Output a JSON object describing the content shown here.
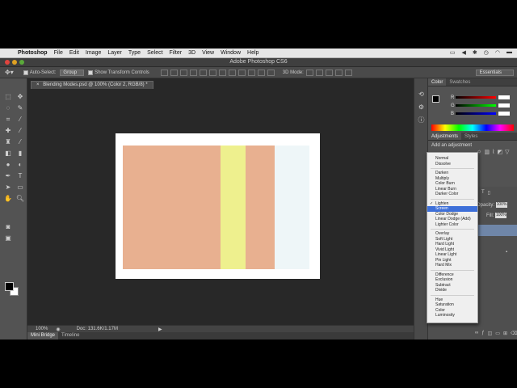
{
  "mac_menubar": {
    "items": [
      "Photoshop",
      "File",
      "Edit",
      "Image",
      "Layer",
      "Type",
      "Select",
      "Filter",
      "3D",
      "View",
      "Window",
      "Help"
    ]
  },
  "window": {
    "title": "Adobe Photoshop CS6"
  },
  "options_bar": {
    "auto_select_label": "Auto-Select:",
    "auto_select_value": "Group",
    "transform_label": "Show Transform Controls",
    "mode_label": "3D Mode:",
    "workspace": "Essentials"
  },
  "document": {
    "tab_title": "Blending Modes.psd @ 100% (Color 2, RGB/8) *",
    "zoom": "100%",
    "doc_size": "Doc: 131.6K/1.17M",
    "bottom_tabs": [
      "Mini Bridge",
      "Timeline"
    ]
  },
  "panels": {
    "color_tabs": [
      "Color",
      "Swatches"
    ],
    "slider_labels": [
      "R",
      "G",
      "B"
    ],
    "adjustments_tabs": [
      "Adjustments",
      "Styles"
    ],
    "add_adjustment": "Add an adjustment",
    "opacity_label": "Opacity:",
    "opacity_value": "100%",
    "fill_label": "Fill:",
    "fill_value": "100%"
  },
  "blend_menu": {
    "groups": [
      [
        {
          "label": "Normal"
        },
        {
          "label": "Dissolve"
        }
      ],
      [
        {
          "label": "Darken"
        },
        {
          "label": "Multiply"
        },
        {
          "label": "Color Burn"
        },
        {
          "label": "Linear Burn"
        },
        {
          "label": "Darker Color"
        }
      ],
      [
        {
          "label": "Lighten",
          "checked": true
        },
        {
          "label": "Screen",
          "highlighted": true
        },
        {
          "label": "Color Dodge"
        },
        {
          "label": "Linear Dodge (Add)"
        },
        {
          "label": "Lighter Color"
        }
      ],
      [
        {
          "label": "Overlay"
        },
        {
          "label": "Soft Light"
        },
        {
          "label": "Hard Light"
        },
        {
          "label": "Vivid Light"
        },
        {
          "label": "Linear Light"
        },
        {
          "label": "Pin Light"
        },
        {
          "label": "Hard Mix"
        }
      ],
      [
        {
          "label": "Difference"
        },
        {
          "label": "Exclusion"
        },
        {
          "label": "Subtract"
        },
        {
          "label": "Divide"
        }
      ],
      [
        {
          "label": "Hue"
        },
        {
          "label": "Saturation"
        },
        {
          "label": "Color"
        },
        {
          "label": "Luminosity"
        }
      ]
    ]
  },
  "colors": {
    "salmon": "#e8b090",
    "yellow": "#eef08e",
    "pale_blue": "#eef6f8",
    "highlight": "#3d6fd8"
  }
}
